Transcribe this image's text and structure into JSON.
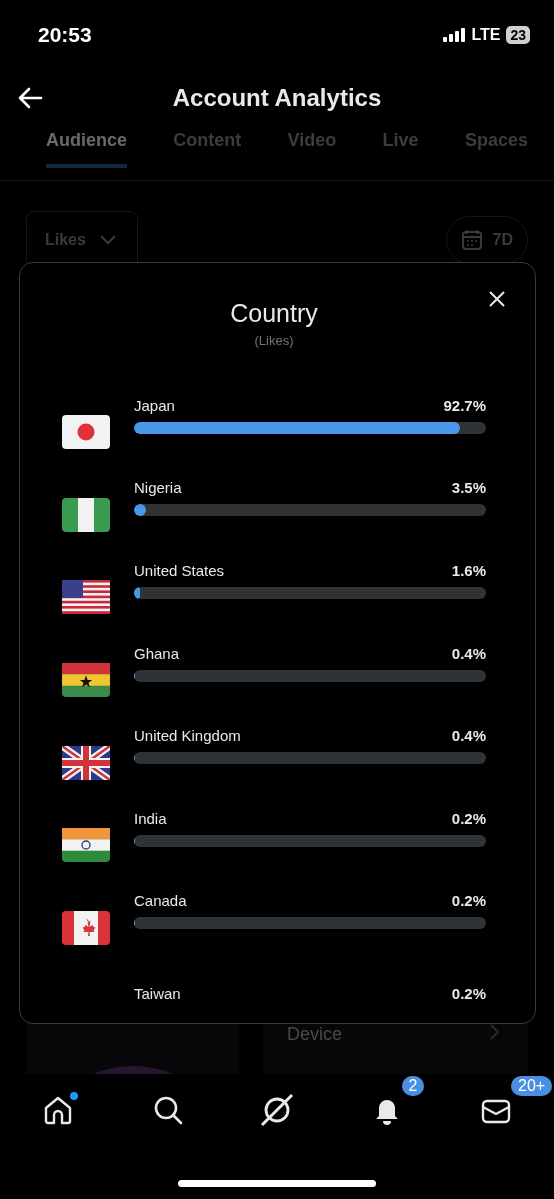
{
  "status_bar": {
    "time": "20:53",
    "network": "LTE",
    "battery": "23"
  },
  "header": {
    "title": "Account Analytics"
  },
  "tabs": [
    {
      "label": "Audience",
      "selected": true
    },
    {
      "label": "Content",
      "selected": false
    },
    {
      "label": "Video",
      "selected": false
    },
    {
      "label": "Live",
      "selected": false
    },
    {
      "label": "Spaces",
      "selected": false
    }
  ],
  "filter": {
    "metric": "Likes",
    "period": "7D"
  },
  "device_card": {
    "title": "Device"
  },
  "modal": {
    "title": "Country",
    "subtitle": "(Likes)",
    "rows": [
      {
        "kind": "japan",
        "name": "Japan",
        "value": "92.7%",
        "level": 0.927
      },
      {
        "kind": "nigeria",
        "name": "Nigeria",
        "value": "3.5%",
        "level": 0.035
      },
      {
        "kind": "usa",
        "name": "United States",
        "value": "1.6%",
        "level": 0.016
      },
      {
        "kind": "ghana",
        "name": "Ghana",
        "value": "0.4%",
        "level": 0.004
      },
      {
        "kind": "uk",
        "name": "United Kingdom",
        "value": "0.4%",
        "level": 0.004
      },
      {
        "kind": "india",
        "name": "India",
        "value": "0.2%",
        "level": 0.002
      },
      {
        "kind": "canada",
        "name": "Canada",
        "value": "0.2%",
        "level": 0.002
      },
      {
        "name": "Taiwan",
        "value": "0.2%"
      }
    ]
  },
  "nav": [
    {
      "kind": "home",
      "unread": true
    },
    {
      "kind": "search",
      "unread": false
    },
    {
      "kind": "explore",
      "unread": false
    },
    {
      "kind": "bell",
      "unread": false,
      "badge": "2"
    },
    {
      "kind": "mail",
      "unread": false,
      "badge": "20+"
    }
  ]
}
